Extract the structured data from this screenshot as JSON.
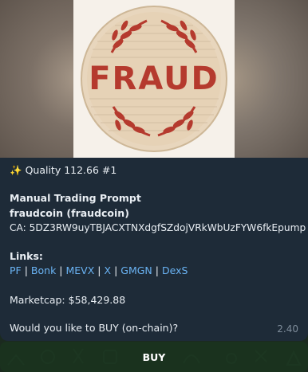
{
  "image": {
    "logo_text": "FRAUD",
    "accent_color": "#b53a2e"
  },
  "message": {
    "quality": "Quality 112.66 #1",
    "heading": "Manual Trading Prompt",
    "token": "fraudcoin (fraudcoin)",
    "ca": "CA: 5DZ3RW9uyTBJACXTNXdgfSZdojVRkWbUzFYW6fkEpump",
    "links_label": "Links:",
    "links": [
      "PF",
      "Bonk",
      "MEVX",
      "X",
      "GMGN",
      "DexS"
    ],
    "link_separator": "|",
    "marketcap": "Marketcap: $58,429.88",
    "prompt": "Would you like to BUY (on-chain)?",
    "time": "2.40",
    "link_color": "#6ab3f3"
  },
  "keyboard": {
    "buy_label": "BUY"
  },
  "icons": {
    "sparkle": "sparkles-icon"
  }
}
